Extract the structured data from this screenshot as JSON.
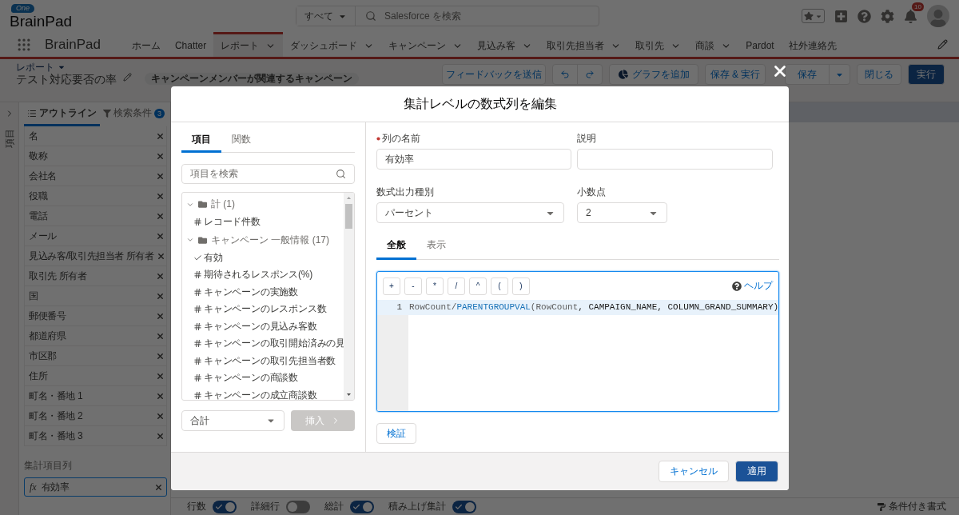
{
  "header": {
    "logo_badge": "One",
    "logo": "BrainPad",
    "search_scope": "すべて",
    "search_placeholder": "Salesforce を検索",
    "notification_count": "10"
  },
  "nav": {
    "app_name": "BrainPad",
    "tabs": [
      {
        "label": "ホーム",
        "selected": false,
        "menu": false
      },
      {
        "label": "Chatter",
        "selected": false,
        "menu": false
      },
      {
        "label": "レポート",
        "selected": true,
        "menu": true
      },
      {
        "label": "ダッシュボード",
        "selected": false,
        "menu": true
      },
      {
        "label": "キャンペーン",
        "selected": false,
        "menu": true
      },
      {
        "label": "見込み客",
        "selected": false,
        "menu": true
      },
      {
        "label": "取引先担当者",
        "selected": false,
        "menu": true
      },
      {
        "label": "取引先",
        "selected": false,
        "menu": true
      },
      {
        "label": "商談",
        "selected": false,
        "menu": true
      },
      {
        "label": "Pardot",
        "selected": false,
        "menu": false
      },
      {
        "label": "社外連絡先",
        "selected": false,
        "menu": false
      }
    ]
  },
  "report": {
    "breadcrumb": "レポート",
    "title": "テスト対応要否の率",
    "report_type": "キャンペーンメンバーが関連するキャンペーン",
    "feedback_button": "フィードバックを送信",
    "add_chart_button": "グラフを追加",
    "save_run_button": "保存 & 実行",
    "save_button": "保存",
    "close_button": "閉じる",
    "run_button": "実行"
  },
  "side_panel": {
    "collapsed_label": "項目"
  },
  "outline": {
    "tabs": [
      {
        "label": "アウトライン",
        "selected": true,
        "kind": "outline"
      },
      {
        "label": "検索条件",
        "selected": false,
        "kind": "filter",
        "count": "3"
      }
    ],
    "columns": [
      "名",
      "敬称",
      "会社名",
      "役職",
      "電話",
      "メール",
      "見込み客/取引先担当者 所有者",
      "取引先 所有者",
      "国",
      "郵便番号",
      "都道府県",
      "市区郡",
      "住所",
      "町名・番地 1",
      "町名・番地 2",
      "町名・番地 3"
    ],
    "summary_label": "集計項目列",
    "summary_columns": [
      {
        "symbol": "fx",
        "label": "有効率"
      }
    ]
  },
  "footer_bar": {
    "toggles": [
      {
        "label": "行数",
        "on": true
      },
      {
        "label": "詳細行",
        "on": false
      },
      {
        "label": "総計",
        "on": true
      },
      {
        "label": "積み上げ集計",
        "on": true
      }
    ],
    "conditional_format": "条件付き書式"
  },
  "modal": {
    "title": "集計レベルの数式列を編集",
    "picker": {
      "tabs": [
        {
          "label": "項目",
          "selected": true
        },
        {
          "label": "関数",
          "selected": false
        }
      ],
      "search_placeholder": "項目を検索",
      "tree": [
        {
          "label": "計 (1)",
          "expanded": true,
          "children": [
            {
              "label": "レコード件数",
              "kind": "number"
            }
          ]
        },
        {
          "label": "キャンペーン 一般情報 (17)",
          "expanded": true,
          "children": [
            {
              "label": "有効",
              "kind": "checkbox"
            },
            {
              "label": "期待されるレスポンス(%)",
              "kind": "number"
            },
            {
              "label": "キャンペーンの実施数",
              "kind": "number"
            },
            {
              "label": "キャンペーンのレスポンス数",
              "kind": "number"
            },
            {
              "label": "キャンペーンの見込み客数",
              "kind": "number"
            },
            {
              "label": "キャンペーンの取引開始済みの見",
              "kind": "number"
            },
            {
              "label": "キャンペーンの取引先担当者数",
              "kind": "number"
            },
            {
              "label": "キャンペーンの商談数",
              "kind": "number"
            },
            {
              "label": "キャンペーンの成立商談数",
              "kind": "number"
            }
          ]
        }
      ],
      "summary_select": "合計",
      "insert_button": {
        "label": "挿入",
        "disabled": true
      }
    },
    "form": {
      "name_label": "列の名前",
      "name_required": true,
      "name_value": "有効率",
      "description_label": "説明",
      "output_type_label": "数式出力種別",
      "output_type_value": "パーセント",
      "decimals_label": "小数点",
      "decimals_value": "2"
    },
    "formula_tabs": [
      {
        "label": "全般",
        "selected": true
      },
      {
        "label": "表示",
        "selected": false
      }
    ],
    "operators": [
      "+",
      "-",
      "*",
      "/",
      "^",
      "(",
      ")"
    ],
    "help_link": "ヘルプ",
    "code_lines": [
      {
        "number": "1",
        "tokens": [
          {
            "text": "RowCount/",
            "kind": "field"
          },
          {
            "text": "PARENTGROUPVAL",
            "kind": "function"
          },
          {
            "text": "(RowCount",
            "kind": "field"
          },
          {
            "text": ", CAMPAIGN_NAME, COLUMN_GRAND_SUMMARY)",
            "kind": "constant"
          }
        ]
      }
    ],
    "validate_button": "検証",
    "cancel_button": "キャンセル",
    "apply_button": "適用"
  }
}
